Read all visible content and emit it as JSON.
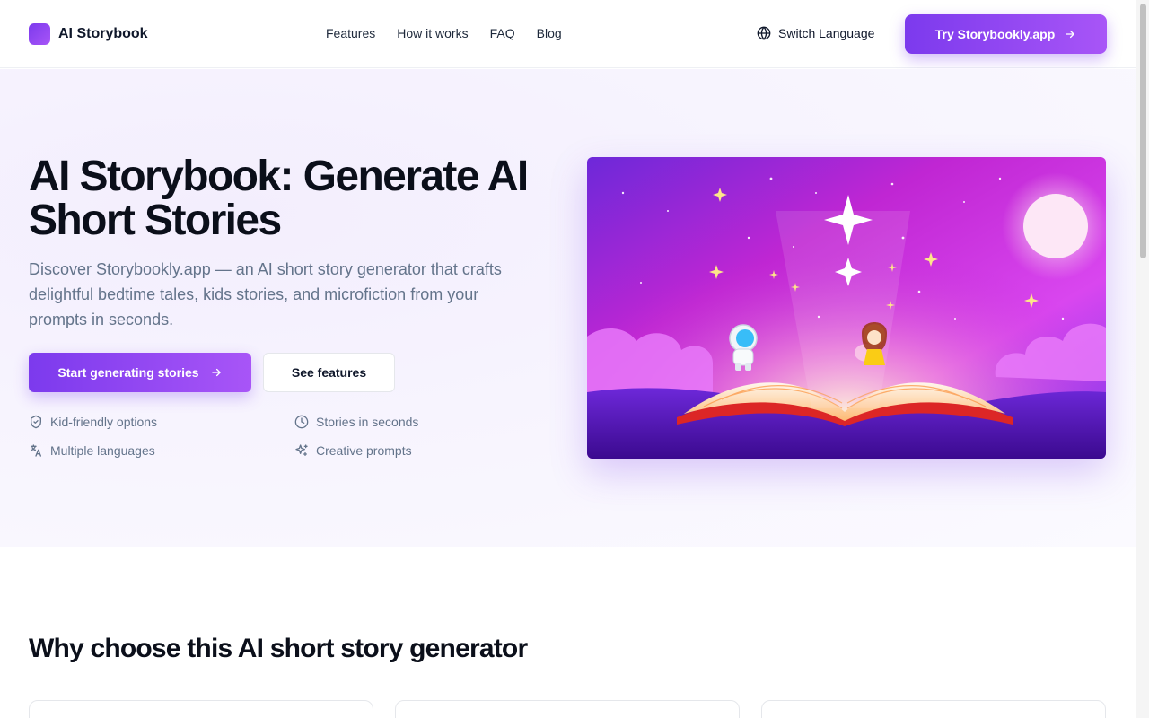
{
  "header": {
    "brand": "AI Storybook",
    "nav": [
      "Features",
      "How it works",
      "FAQ",
      "Blog"
    ],
    "language_label": "Switch Language",
    "cta_label": "Try Storybookly.app"
  },
  "hero": {
    "title": "AI Storybook: Generate AI Short Stories",
    "subtitle": "Discover Storybookly.app — an AI short story generator that crafts delightful bedtime tales, kids stories, and microfiction from your prompts in seconds.",
    "primary_button": "Start generating stories",
    "secondary_button": "See features",
    "features": [
      "Kid-friendly options",
      "Stories in seconds",
      "Multiple languages",
      "Creative prompts"
    ]
  },
  "section": {
    "title": "Why choose this AI short story generator"
  },
  "colors": {
    "accent": "#7c3aed",
    "accent_light": "#a855f7"
  },
  "icons": [
    "globe-icon",
    "arrow-right-icon",
    "shield-icon",
    "clock-icon",
    "translate-icon",
    "sparkle-icon"
  ]
}
